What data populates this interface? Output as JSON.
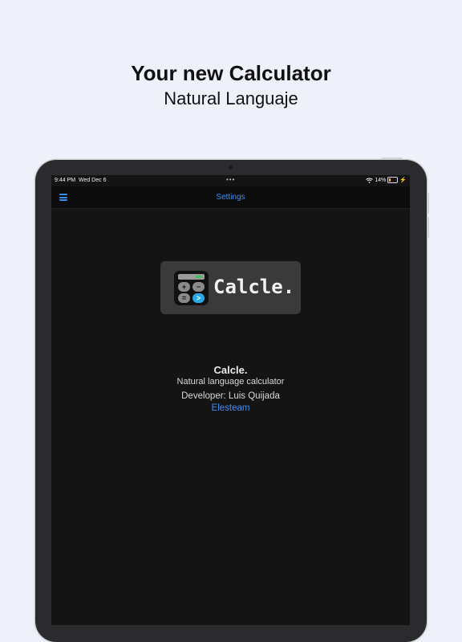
{
  "promo": {
    "headline": "Your new Calculator",
    "subline": "Natural Languaje"
  },
  "status_bar": {
    "time": "9:44 PM",
    "date": "Wed Dec 6",
    "dots": "•••",
    "battery": "14%",
    "wifi_icon": "wifi-icon",
    "battery_icon": "battery-charging-icon"
  },
  "nav": {
    "menu_icon": "hamburger-menu-icon",
    "title": "Settings"
  },
  "logo": {
    "text": "Calcle.",
    "icon": "calculator-icon",
    "buttons": [
      "+",
      "−",
      "=",
      ">"
    ]
  },
  "about": {
    "app_name": "Calcle.",
    "description": "Natural language calculator",
    "developer": "Developer: Luis Quijada",
    "company_link": "Elesteam"
  },
  "colors": {
    "accent": "#3b8ef0",
    "background": "#eef1fa",
    "screen": "#141414"
  }
}
